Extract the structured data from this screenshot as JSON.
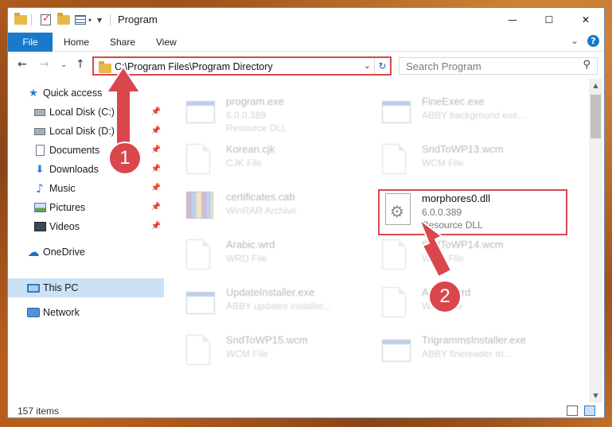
{
  "window": {
    "title": "Program",
    "minimize_glyph": "—",
    "maximize_glyph": "☐",
    "close_glyph": "✕"
  },
  "ribbon": {
    "tabs": [
      "File",
      "Home",
      "Share",
      "View"
    ],
    "collapse_glyph": "⌄",
    "help_glyph": "?"
  },
  "nav": {
    "back_glyph": "←",
    "forward_glyph": "→",
    "recent_glyph": "⌄",
    "up_glyph": "↑",
    "address_path": "C:\\Program Files\\Program Directory",
    "address_dropdown_glyph": "⌄",
    "refresh_glyph": "↻",
    "search_placeholder": "Search Program",
    "search_glyph": "⚲"
  },
  "sidebar": {
    "items": [
      {
        "label": "Quick access",
        "icon": "star-icon",
        "glyph": "★",
        "pinned": false
      },
      {
        "label": "Local Disk (C:)",
        "icon": "drive-icon",
        "pinned": true
      },
      {
        "label": "Local Disk (D:)",
        "icon": "drive-icon",
        "pinned": true
      },
      {
        "label": "Documents",
        "icon": "document-icon",
        "pinned": true
      },
      {
        "label": "Downloads",
        "icon": "download-icon",
        "glyph": "⬇",
        "pinned": true
      },
      {
        "label": "Music",
        "icon": "music-icon",
        "glyph": "♪",
        "pinned": true
      },
      {
        "label": "Pictures",
        "icon": "picture-icon",
        "pinned": true
      },
      {
        "label": "Videos",
        "icon": "video-icon",
        "pinned": true
      },
      {
        "label": "OneDrive",
        "icon": "cloud-icon",
        "glyph": "☁",
        "pinned": false
      },
      {
        "label": "This PC",
        "icon": "computer-icon",
        "pinned": false,
        "selected": true
      },
      {
        "label": "Network",
        "icon": "network-icon",
        "pinned": false
      }
    ],
    "pin_glyph": "📌"
  },
  "files": [
    {
      "name": "program.exe",
      "line2": "6.0.0.389",
      "line3": "Resource DLL",
      "icon": "exe-icon",
      "faded": true
    },
    {
      "name": "FineExec.exe",
      "line2": "ABBY background exe...",
      "line3": "",
      "icon": "exe-icon",
      "faded": true
    },
    {
      "name": "Korean.cjk",
      "line2": "CJK File",
      "line3": "",
      "icon": "file-icon",
      "faded": true
    },
    {
      "name": "SndToWP13.wcm",
      "line2": "WCM File",
      "line3": "",
      "icon": "file-icon",
      "faded": true
    },
    {
      "name": "certificates.cab",
      "line2": "WinRAR Archive",
      "line3": "",
      "icon": "archive-icon",
      "faded": true
    },
    {
      "name": "morphores0.dll",
      "line2": "6.0.0.389",
      "line3": "Resource DLL",
      "icon": "dll-icon",
      "faded": false
    },
    {
      "name": "Arabic.wrd",
      "line2": "WRD File",
      "line3": "",
      "icon": "file-icon",
      "faded": true
    },
    {
      "name": "SndToWP14.wcm",
      "line2": "WCM File",
      "line3": "",
      "icon": "file-icon",
      "faded": true
    },
    {
      "name": "UpdateInstaller.exe",
      "line2": "ABBY updates installer...",
      "line3": "",
      "icon": "exe-icon",
      "faded": true
    },
    {
      "name": "Arabic.wrd",
      "line2": "WRD File",
      "line3": "",
      "icon": "file-icon",
      "faded": true
    },
    {
      "name": "SndToWP15.wcm",
      "line2": "WCM File",
      "line3": "",
      "icon": "file-icon",
      "faded": true
    },
    {
      "name": "TrigrammsInstaller.exe",
      "line2": "ABBY finereader tri...",
      "line3": "",
      "icon": "exe-icon",
      "faded": true
    }
  ],
  "status": {
    "item_count": "157 items"
  },
  "annotations": {
    "step1": "1",
    "step2": "2",
    "color": "#d9474d"
  }
}
